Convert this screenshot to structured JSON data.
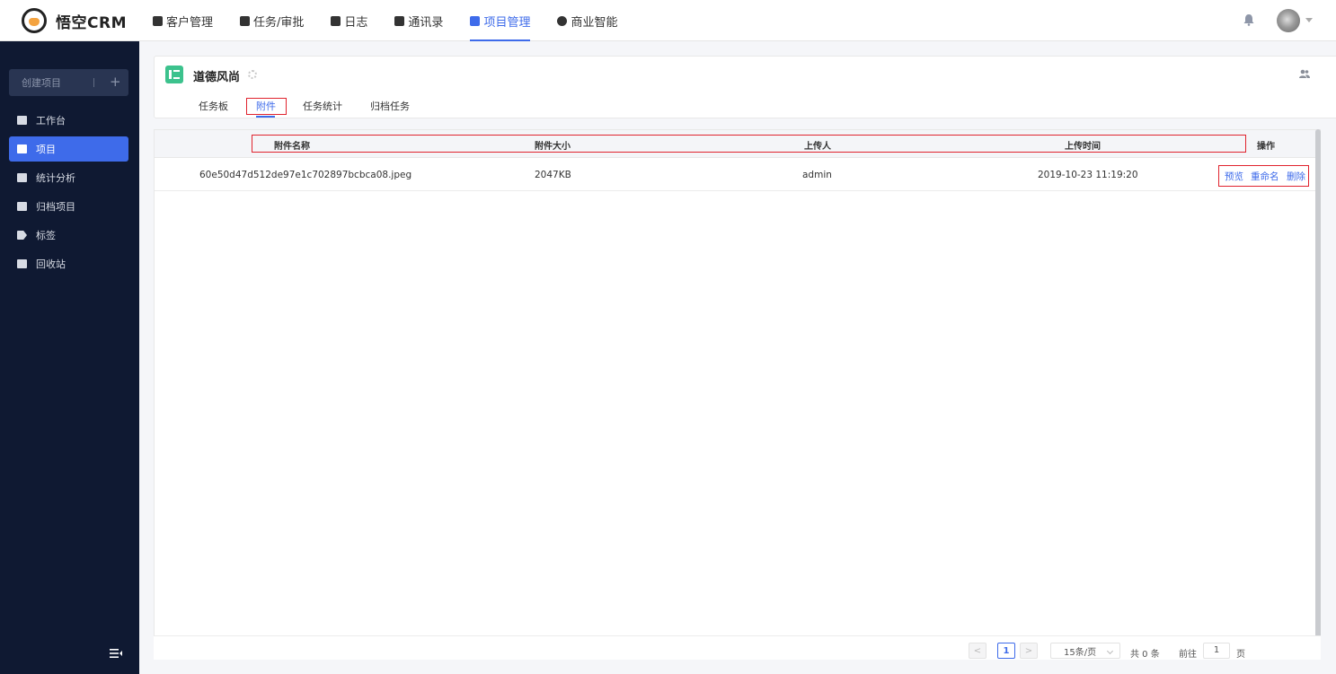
{
  "header": {
    "logo_text": "悟空CRM",
    "nav": [
      {
        "label": "客户管理"
      },
      {
        "label": "任务/审批"
      },
      {
        "label": "日志"
      },
      {
        "label": "通讯录"
      },
      {
        "label": "项目管理",
        "active": true
      },
      {
        "label": "商业智能"
      }
    ]
  },
  "sidebar": {
    "create_label": "创建项目",
    "create_plus": "+",
    "items": [
      {
        "label": "工作台"
      },
      {
        "label": "项目",
        "active": true
      },
      {
        "label": "统计分析"
      },
      {
        "label": "归档项目"
      },
      {
        "label": "标签"
      },
      {
        "label": "回收站"
      }
    ]
  },
  "project": {
    "name": "道德风尚",
    "tabs": [
      {
        "label": "任务板"
      },
      {
        "label": "附件",
        "active": true
      },
      {
        "label": "任务统计"
      },
      {
        "label": "归档任务"
      }
    ]
  },
  "table": {
    "columns": [
      "附件名称",
      "附件大小",
      "上传人",
      "上传时间",
      "操作"
    ],
    "rows": [
      {
        "name": "60e50d47d512de97e1c702897bcbca08.jpeg",
        "size": "2047KB",
        "uploader": "admin",
        "time": "2019-10-23 11:19:20",
        "actions": [
          "预览",
          "重命名",
          "删除"
        ]
      }
    ]
  },
  "pagination": {
    "prev": "<",
    "current_page": "1",
    "next": ">",
    "page_size": "15条/页",
    "total": "共 0 条",
    "goto_label": "前往",
    "goto_value": "1",
    "page_suffix": "页"
  },
  "colors": {
    "accent": "#3e6bea",
    "sidebar_bg": "#0f1932",
    "project_icon": "#3cc28d",
    "highlight": "#e0232e"
  }
}
